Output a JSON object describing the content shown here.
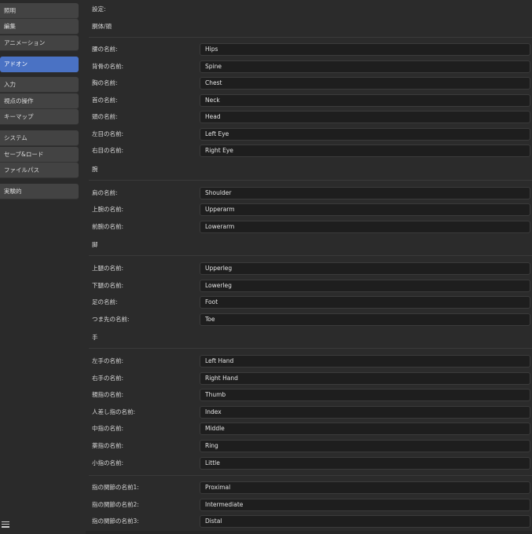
{
  "sidebar": {
    "items": [
      {
        "label": "照明",
        "active": false
      },
      {
        "label": "編集",
        "active": false
      },
      {
        "label": "アニメーション",
        "active": false
      },
      {
        "label": "アドオン",
        "active": true
      },
      {
        "label": "入力",
        "active": false
      },
      {
        "label": "視点の操作",
        "active": false
      },
      {
        "label": "キーマップ",
        "active": false
      },
      {
        "label": "システム",
        "active": false
      },
      {
        "label": "セーブ&ロード",
        "active": false
      },
      {
        "label": "ファイルパス",
        "active": false
      },
      {
        "label": "実験的",
        "active": false
      }
    ],
    "menu_icon": "hamburger-icon",
    "accent_color": "#4a72c4"
  },
  "main": {
    "settings_label": "設定:",
    "sections": {
      "body": "胴体/頭",
      "arm": "腕",
      "leg": "脚",
      "hand": "手"
    },
    "fields": [
      {
        "label": "腰の名前:",
        "value": "Hips"
      },
      {
        "label": "背骨の名前:",
        "value": "Spine"
      },
      {
        "label": "胸の名前:",
        "value": "Chest"
      },
      {
        "label": "首の名前:",
        "value": "Neck"
      },
      {
        "label": "頭の名前:",
        "value": "Head"
      },
      {
        "label": "左目の名前:",
        "value": "Left Eye"
      },
      {
        "label": "右目の名前:",
        "value": "Right Eye"
      },
      {
        "label": "肩の名前:",
        "value": "Shoulder"
      },
      {
        "label": "上腕の名前:",
        "value": "Upperarm"
      },
      {
        "label": "前腕の名前:",
        "value": "Lowerarm"
      },
      {
        "label": "上腿の名前:",
        "value": "Upperleg"
      },
      {
        "label": "下腿の名前:",
        "value": "Lowerleg"
      },
      {
        "label": "足の名前:",
        "value": "Foot"
      },
      {
        "label": "つま先の名前:",
        "value": "Toe"
      },
      {
        "label": "左手の名前:",
        "value": "Left Hand"
      },
      {
        "label": "右手の名前:",
        "value": "Right Hand"
      },
      {
        "label": "親指の名前:",
        "value": "Thumb"
      },
      {
        "label": "人差し指の名前:",
        "value": "Index"
      },
      {
        "label": "中指の名前:",
        "value": "Middle"
      },
      {
        "label": "薬指の名前:",
        "value": "Ring"
      },
      {
        "label": "小指の名前:",
        "value": "Little"
      },
      {
        "label": "指の関節の名前1:",
        "value": "Proximal"
      },
      {
        "label": "指の関節の名前2:",
        "value": "Intermediate"
      },
      {
        "label": "指の関節の名前3:",
        "value": "Distal"
      }
    ]
  }
}
